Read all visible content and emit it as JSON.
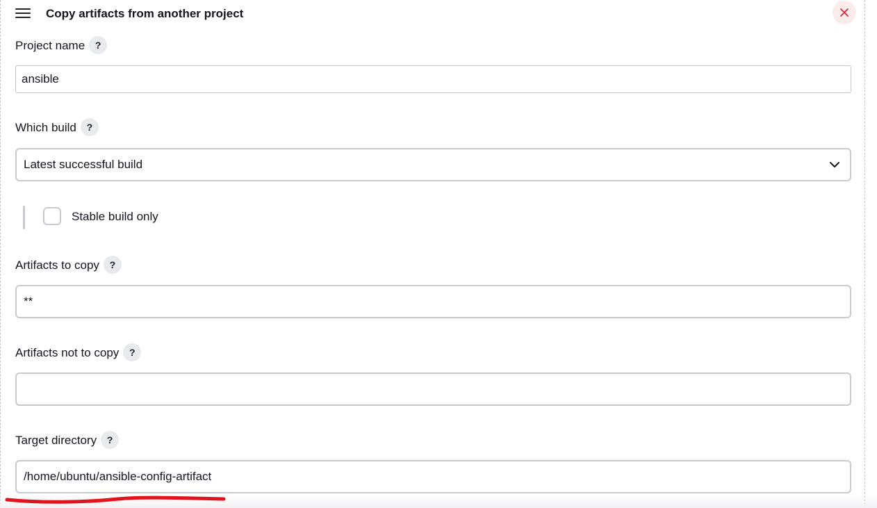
{
  "section": {
    "title": "Copy artifacts from another project",
    "close_glyph": "×"
  },
  "fields": {
    "project_name": {
      "label": "Project name",
      "value": "ansible"
    },
    "which_build": {
      "label": "Which build",
      "selected": "Latest successful build"
    },
    "stable_build_only": {
      "label": "Stable build only",
      "checked": false
    },
    "artifacts_to_copy": {
      "label": "Artifacts to copy",
      "value": "**"
    },
    "artifacts_not_to_copy": {
      "label": "Artifacts not to copy",
      "value": ""
    },
    "target_directory": {
      "label": "Target directory",
      "value": "/home/ubuntu/ansible-config-artifact"
    }
  },
  "help_glyph": "?",
  "icons": {
    "drag_handle": "hamburger-icon",
    "close": "close-icon",
    "dropdown": "chevron-down-icon",
    "help": "help-icon"
  },
  "colors": {
    "close_icon": "#d61e2c",
    "close_bg": "#fbecec",
    "annotation_stroke": "#e0141c",
    "input_border": "#c6cbd2",
    "help_bg": "#e9eaee"
  }
}
